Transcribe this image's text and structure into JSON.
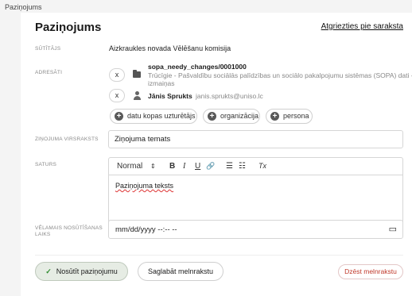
{
  "breadcrumb": "Paziņojums",
  "page": {
    "title": "Paziņojums",
    "back_link": "Atgriezties pie saraksta"
  },
  "labels": {
    "sender": "SŪTĪTĀJS",
    "recipients": "ADRESĀTI",
    "subject": "ZIŅOJUMA VIRSRAKSTS",
    "content": "SATURS",
    "send_time_1": "VĒLAMAIS NOSŪTĪŠANAS",
    "send_time_2": "LAIKS"
  },
  "sender": "Aizkraukles novada Vēlēšanu komisija",
  "recipients": [
    {
      "remove": "x",
      "icon": "folder-icon",
      "name": "sopa_needy_changes/0001000",
      "desc": "Trūcīgie - Pašvaldību sociālās palīdzības un sociālo pakalpojumu sistēmas (SOPA) dati - izmaiņas"
    },
    {
      "remove": "x",
      "icon": "person-icon",
      "name": "Jānis Sprukts",
      "email": "janis.sprukts@uniso.lc"
    }
  ],
  "add_buttons": [
    "datu kopas uzturētājs",
    "organizācija",
    "persona"
  ],
  "subject_value": "Ziņojuma temats",
  "editor": {
    "format": "Normal",
    "format_arrow": "⇕",
    "bold": "B",
    "italic": "I",
    "underline": "U",
    "link": "🔗",
    "ordered_list": "☰",
    "bullet_list": "☷",
    "clear": "Tx",
    "body": "Paziņojuma teksts"
  },
  "datetime_placeholder": "mm/dd/yyyy --:-- --",
  "calendar_icon": "▭",
  "buttons": {
    "send": "Nosūtīt paziņojumu",
    "send_icon": "✓",
    "save_draft": "Saglabāt melnrakstu",
    "delete_draft": "Dzēst melnrakstu"
  }
}
